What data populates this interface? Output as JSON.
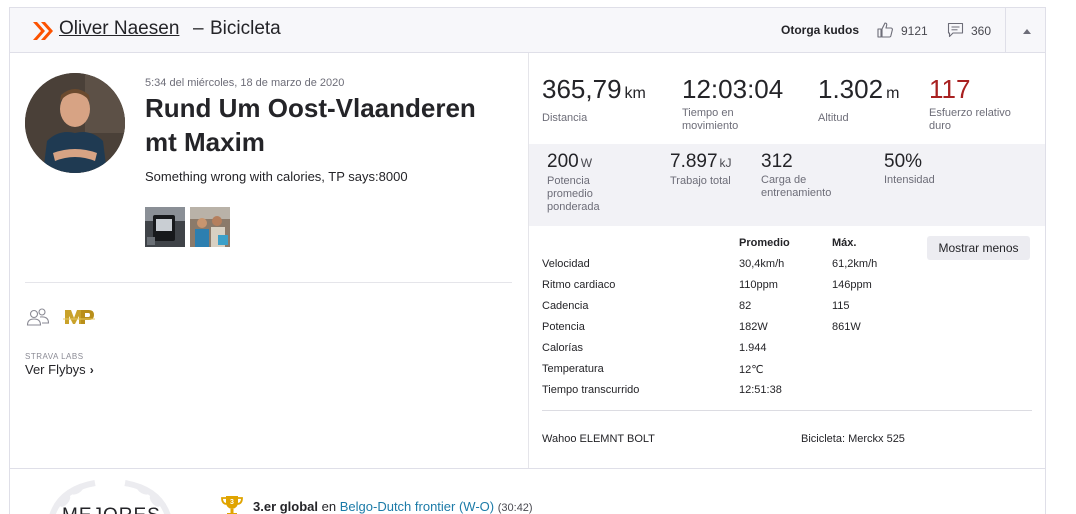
{
  "colors": {
    "brand_orange": "#fc5200",
    "relative_effort_red": "#a82020",
    "link_blue": "#1c7ba8",
    "trophy_gold": "#e0a400"
  },
  "header": {
    "athlete": "Oliver Naesen",
    "separator": "–",
    "activity_type": "Bicicleta",
    "kudos_label": "Otorga kudos",
    "kudos_count": "9121",
    "comment_count": "360",
    "icons": [
      "double-chevron-icon",
      "thumbs-up-icon",
      "comment-icon",
      "collapse-triangle-icon"
    ]
  },
  "activity": {
    "date": "5:34 del miércoles, 18 de marzo de 2020",
    "title": "Rund Um Oost-Vlaanderen mt Maxim",
    "description": "Something wrong with calories, TP says:8000",
    "photos": [
      "bike-computer-photo",
      "group-ride-photo"
    ]
  },
  "left_footer": {
    "icons": [
      "people-icon",
      "mp-logo-icon"
    ],
    "labs_label": "STRAVA LABS",
    "flyby_label": "Ver Flybys",
    "flyby_chevron": "›"
  },
  "primary_stats": [
    {
      "value": "365,79",
      "unit": "km",
      "label": "Distancia"
    },
    {
      "value": "12:03:04",
      "unit": "",
      "label": "Tiempo en movimiento"
    },
    {
      "value": "1.302",
      "unit": "m",
      "label": "Altitud"
    },
    {
      "value": "117",
      "unit": "",
      "label": "Esfuerzo relativo duro"
    }
  ],
  "secondary_stats": [
    {
      "value": "200",
      "unit": "W",
      "label": "Potencia promedio ponderada"
    },
    {
      "value": "7.897",
      "unit": "kJ",
      "label": "Trabajo total"
    },
    {
      "value": "312",
      "unit": "",
      "label": "Carga de entrenamiento"
    },
    {
      "value": "50%",
      "unit": "",
      "label": "Intensidad"
    }
  ],
  "details": {
    "col_avg": "Promedio",
    "col_max": "Máx.",
    "show_less": "Mostrar menos",
    "rows": [
      {
        "label": "Velocidad",
        "avg": "30,4km/h",
        "max": "61,2km/h"
      },
      {
        "label": "Ritmo cardiaco",
        "avg": "110ppm",
        "max": "146ppm"
      },
      {
        "label": "Cadencia",
        "avg": "82",
        "max": "115"
      },
      {
        "label": "Potencia",
        "avg": "182W",
        "max": "861W"
      },
      {
        "label": "Calorías",
        "avg": "1.944",
        "max": ""
      },
      {
        "label": "Temperatura",
        "avg": "12℃",
        "max": ""
      },
      {
        "label": "Tiempo transcurrido",
        "avg": "12:51:38",
        "max": ""
      }
    ],
    "device": "Wahoo ELEMNT BOLT",
    "bike": "Bicicleta: Merckx 525"
  },
  "achievements": {
    "section_label": "MEJORES",
    "items": [
      {
        "rank": "3.er global",
        "connector": "en",
        "segment": "Belgo-Dutch frontier (W-O)",
        "time": "(30:42)"
      }
    ]
  }
}
